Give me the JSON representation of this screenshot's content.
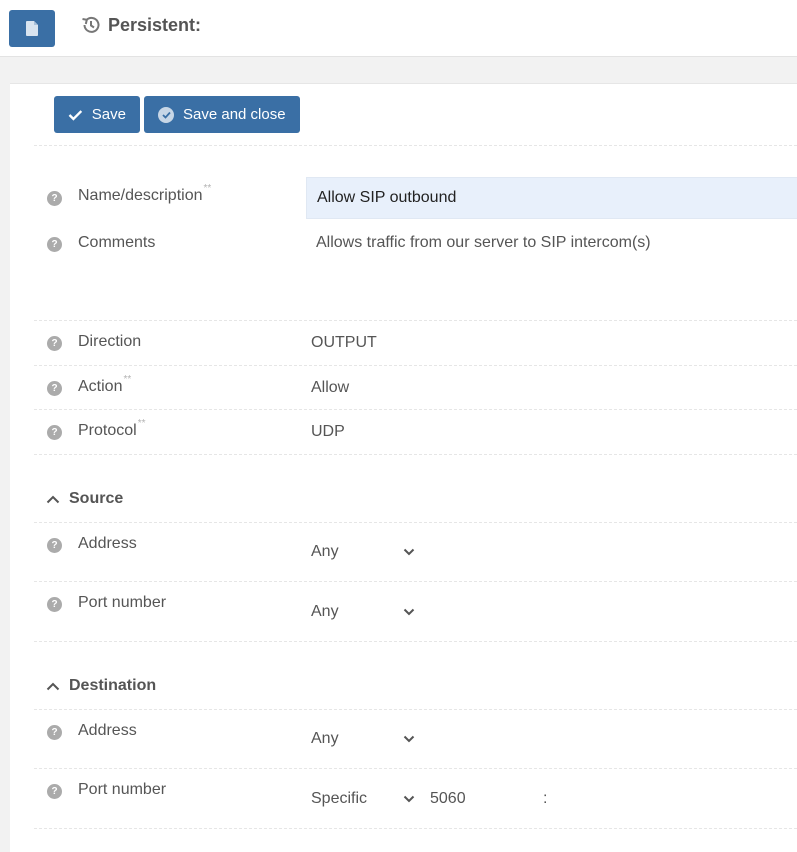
{
  "header": {
    "doc_icon": "document-icon",
    "history_icon": "history-icon",
    "title": "Persistent:"
  },
  "toolbar": {
    "save_label": "Save",
    "save_close_label": "Save and close"
  },
  "form": {
    "name": {
      "label": "Name/description",
      "required_mark": "**",
      "value": "Allow SIP outbound"
    },
    "comments": {
      "label": "Comments",
      "value": "Allows traffic from our server to SIP intercom(s)"
    },
    "direction": {
      "label": "Direction",
      "value": "OUTPUT"
    },
    "action": {
      "label": "Action",
      "required_mark": "**",
      "value": "Allow"
    },
    "protocol": {
      "label": "Protocol",
      "required_mark": "**",
      "value": "UDP"
    }
  },
  "source": {
    "title": "Source",
    "address": {
      "label": "Address",
      "value": "Any"
    },
    "port": {
      "label": "Port number",
      "value": "Any"
    }
  },
  "destination": {
    "title": "Destination",
    "address": {
      "label": "Address",
      "value": "Any"
    },
    "port": {
      "label": "Port number",
      "value": "Specific",
      "port_value": "5060",
      "separator": ":"
    }
  },
  "help_glyph": "?",
  "colors": {
    "primary": "#3a6fa5",
    "input_bg": "#e8f0fb",
    "help_bg": "#ababab"
  }
}
